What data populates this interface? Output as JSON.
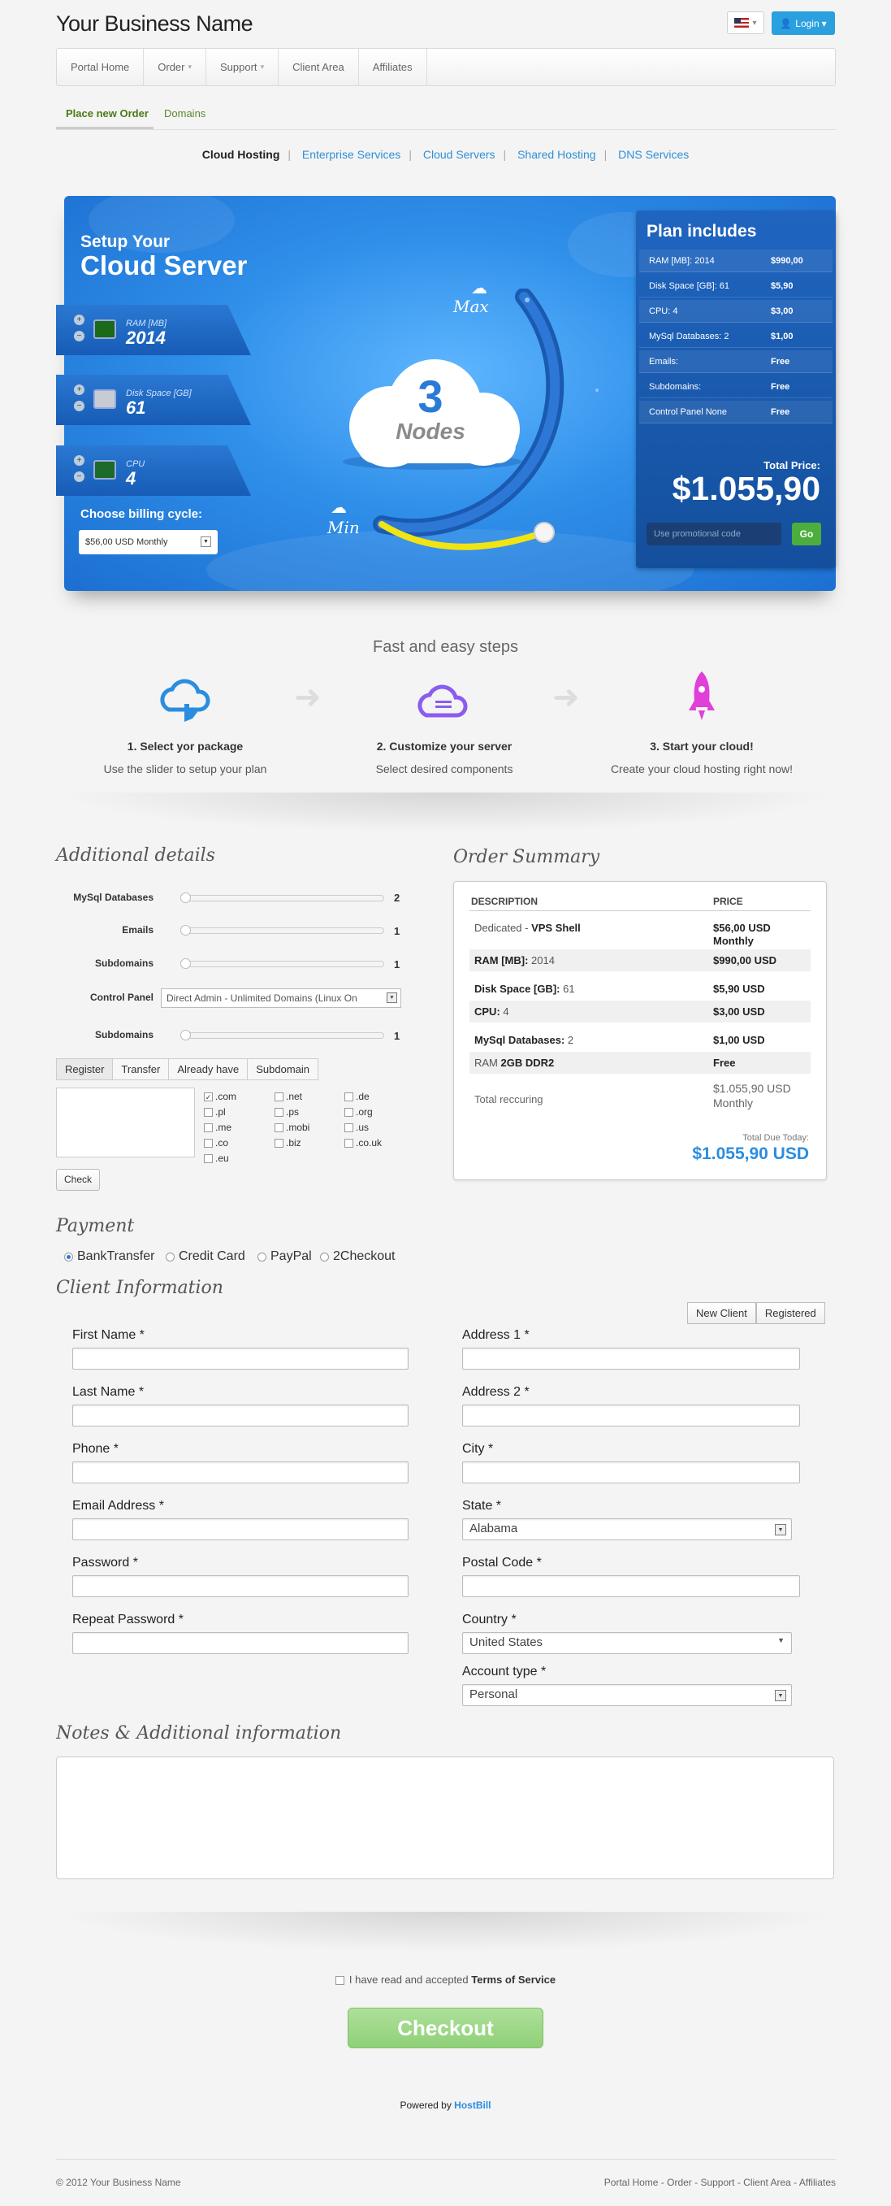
{
  "brand": "Your Business Name",
  "header": {
    "login_label": "Login",
    "flag_icon": "us-flag-icon"
  },
  "topnav": [
    "Portal Home",
    "Order",
    "Support",
    "Client Area",
    "Affiliates"
  ],
  "subtabs": {
    "active": "Place new Order",
    "other": "Domains"
  },
  "product_nav": [
    "Cloud Hosting",
    "Enterprise Services",
    "Cloud Servers",
    "Shared Hosting",
    "DNS Services"
  ],
  "hero": {
    "title_small": "Setup Your",
    "title_big": "Cloud Server",
    "ram_label": "RAM [MB]",
    "ram_value": "2014",
    "disk_label": "Disk Space [GB]",
    "disk_value": "61",
    "cpu_label": "CPU",
    "cpu_value": "4",
    "billing_label": "Choose billing cycle:",
    "billing_value": "$56,00 USD Monthly",
    "nodes_number": "3",
    "nodes_label": "Nodes",
    "max_label": "Max",
    "min_label": "Min",
    "slider_level": 0.0
  },
  "plan": {
    "title": "Plan includes",
    "rows": [
      {
        "k": "RAM [MB]: 2014",
        "v": "$990,00"
      },
      {
        "k": "Disk Space [GB]: 61",
        "v": "$5,90"
      },
      {
        "k": "CPU: 4",
        "v": "$3,00"
      },
      {
        "k": "MySql Databases: 2",
        "v": "$1,00"
      },
      {
        "k": "Emails:",
        "v": "Free"
      },
      {
        "k": "Subdomains:",
        "v": "Free"
      },
      {
        "k": "Control Panel None",
        "v": "Free"
      }
    ],
    "total_label": "Total Price:",
    "total_value": "$1.055,90",
    "promo_placeholder": "Use promotional code",
    "go_label": "Go"
  },
  "steps": {
    "title": "Fast and easy steps",
    "items": [
      {
        "h": "1. Select yor package",
        "s": "Use the slider to setup your plan",
        "icon": "cloud-hand-icon"
      },
      {
        "h": "2. Customize your server",
        "s": "Select desired components",
        "icon": "cloud-list-icon"
      },
      {
        "h": "3. Start your cloud!",
        "s": "Create your cloud hosting right now!",
        "icon": "rocket-icon"
      }
    ]
  },
  "details": {
    "title": "Additional details",
    "rows": [
      {
        "label": "MySql Databases",
        "value": "2"
      },
      {
        "label": "Emails",
        "value": "1"
      },
      {
        "label": "Subdomains",
        "value": "1"
      },
      {
        "label": "Control Panel",
        "value": "Direct Admin - Unlimited Domains (Linux On"
      },
      {
        "label": "Subdomains",
        "value": "1"
      }
    ],
    "domain_tabs": [
      "Register",
      "Transfer",
      "Already have",
      "Subdomain"
    ],
    "tlds": [
      ".com",
      ".net",
      ".de",
      ".pl",
      ".ps",
      ".org",
      ".me",
      ".mobi",
      ".us",
      ".co",
      ".biz",
      ".co.uk",
      ".eu"
    ],
    "check_label": "Check"
  },
  "summary": {
    "title": "Order Summary",
    "col_desc": "DESCRIPTION",
    "col_price": "PRICE",
    "rows": [
      {
        "d1": "Dedicated - ",
        "d2": "VPS Shell",
        "p": "$56,00 USD",
        "p2": "Monthly"
      },
      {
        "d1": "RAM [MB]: ",
        "d2": "2014",
        "p": "$990,00 USD"
      },
      {
        "d1": "Disk Space [GB]: ",
        "d2": "61",
        "p": "$5,90 USD"
      },
      {
        "d1": "CPU: ",
        "d2": "4",
        "p": "$3,00 USD"
      },
      {
        "d1": "MySql Databases: ",
        "d2": "2",
        "p": "$1,00 USD"
      },
      {
        "d1": "RAM ",
        "d2": "2GB DDR2",
        "p": "Free"
      }
    ],
    "recurring_label": "Total reccuring",
    "recurring_value": "$1.055,90 USD",
    "recurring_period": "Monthly",
    "due_label": "Total Due Today:",
    "due_value": "$1.055,90 USD"
  },
  "payment": {
    "title": "Payment",
    "options": [
      "BankTransfer",
      "Credit Card",
      "PayPal",
      "2Checkout"
    ]
  },
  "client": {
    "title": "Client Information",
    "new_label": "New Client",
    "registered_label": "Registered",
    "left": [
      "First Name *",
      "Last Name *",
      "Phone *",
      "Email Address *",
      "Password *",
      "Repeat Password *"
    ],
    "right": [
      "Address 1 *",
      "Address 2 *",
      "City *",
      "State *",
      "Postal Code *",
      "Country *",
      "Account type *"
    ],
    "state_value": "Alabama",
    "country_value": "United States",
    "account_value": "Personal"
  },
  "notes_title": "Notes & Additional information",
  "tos": {
    "text": "I have read and accepted ",
    "link": "Terms of Service"
  },
  "checkout_label": "Checkout",
  "powered": {
    "text": "Powered by ",
    "link": "HostBill"
  },
  "footer": {
    "left": "© 2012 Your Business Name",
    "right": "Portal Home - Order - Support - Client Area - Affiliates"
  },
  "colors": {
    "accent": "#2a8de0",
    "checkout": "#9fd88a",
    "hero": "#2f8fe9"
  }
}
